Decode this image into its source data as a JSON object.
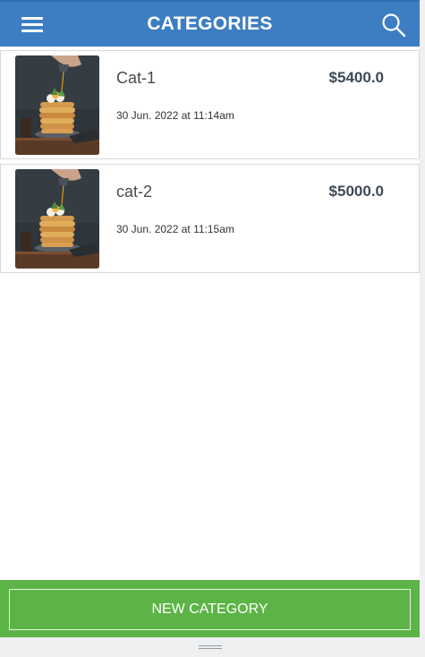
{
  "header": {
    "title": "CATEGORIES",
    "menu_icon": "menu-icon",
    "search_icon": "search-icon",
    "background": "#3d7ec2"
  },
  "categories": [
    {
      "name": "Cat-1",
      "price": "$5400.0",
      "date": "30 Jun. 2022 at 11:14am",
      "image": "pancake-stack-photo"
    },
    {
      "name": "cat-2",
      "price": "$5000.0",
      "date": "30 Jun. 2022 at 11:15am",
      "image": "pancake-stack-photo"
    }
  ],
  "footer": {
    "button_label": "NEW CATEGORY",
    "background": "#5db446"
  }
}
